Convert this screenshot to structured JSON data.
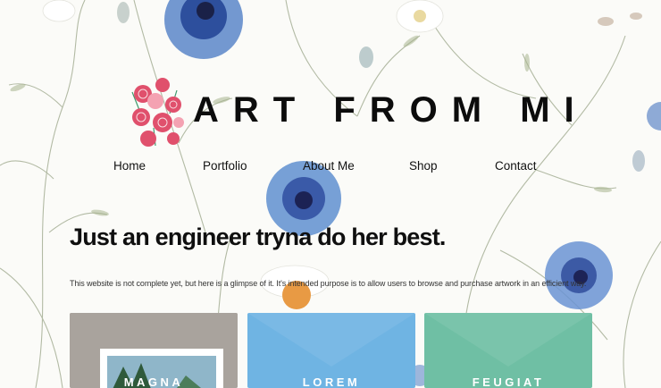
{
  "site": {
    "title": "ART FROM MI"
  },
  "nav": {
    "items": [
      "Home",
      "Portfolio",
      "About Me",
      "Shop",
      "Contact"
    ]
  },
  "hero": {
    "headline": "Just an engineer tryna do her best.",
    "description": "This website is not complete yet, but here is a glimpse of it. It's intended purpose is to allow users to browse and purchase artwork in an efficient way."
  },
  "cards": [
    {
      "label": "MAGNA"
    },
    {
      "label": "LOREM",
      "color": "#6fb4e3"
    },
    {
      "label": "FEUGIAT",
      "color": "#6fbfa4"
    }
  ]
}
